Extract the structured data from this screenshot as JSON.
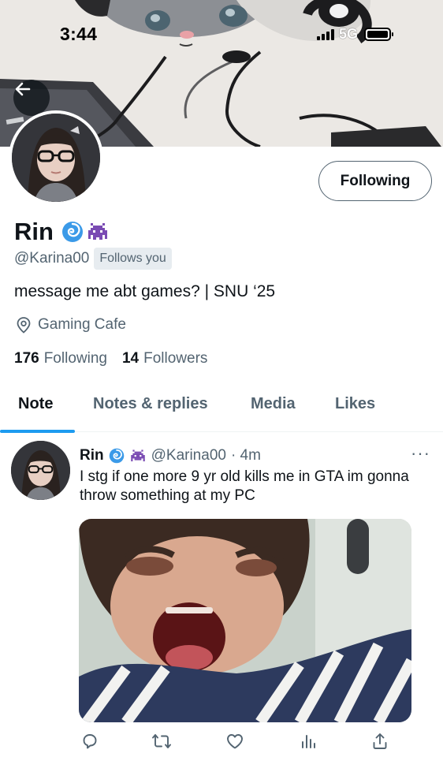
{
  "status_bar": {
    "time": "3:44",
    "network": "5G"
  },
  "profile": {
    "display_name": "Rin",
    "badges": [
      "cyclone-emoji",
      "alien-monster-emoji"
    ],
    "handle": "@Karina00",
    "follows_you": "Follows you",
    "follow_button": "Following",
    "bio": "message me abt games? | SNU ‘25",
    "location": "Gaming Cafe",
    "following_count": "176",
    "following_label": "Following",
    "followers_count": "14",
    "followers_label": "Followers"
  },
  "tabs": [
    {
      "label": "Note",
      "active": true
    },
    {
      "label": "Notes & replies",
      "active": false
    },
    {
      "label": "Media",
      "active": false
    },
    {
      "label": "Likes",
      "active": false
    }
  ],
  "post": {
    "author": "Rin",
    "handle": "@Karina00",
    "meta": "· 4m",
    "text": "I stg if one more 9 yr old kills me in GTA im gonna throw something at my PC",
    "more": "···"
  },
  "actions": [
    "reply-icon",
    "repost-icon",
    "like-icon",
    "views-icon",
    "share-icon"
  ],
  "colors": {
    "accent": "#1d9bf0",
    "text_primary": "#0f1419",
    "text_secondary": "#536471"
  }
}
